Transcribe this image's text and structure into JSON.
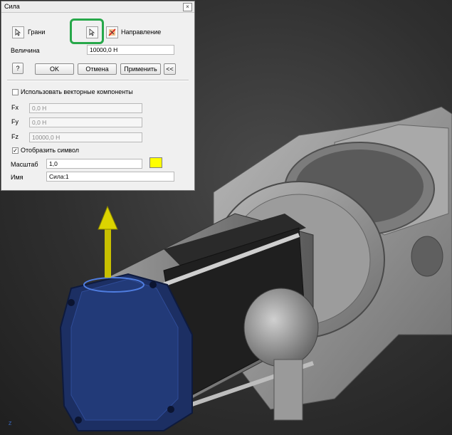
{
  "dialog": {
    "title": "Сила",
    "close_glyph": "×",
    "faces_label": "Грани",
    "direction_label": "Направление",
    "magnitude_label": "Величина",
    "magnitude_value": "10000,0 Н",
    "help_glyph": "?",
    "ok_label": "OK",
    "cancel_label": "Отмена",
    "apply_label": "Применить",
    "more_label": "<<",
    "vector_components_label": "Использовать векторные компоненты",
    "vector_components_checked": false,
    "fx_label": "Fx",
    "fx_value": "0,0 Н",
    "fy_label": "Fy",
    "fy_value": "0,0 Н",
    "fz_label": "Fz",
    "fz_value": "10000,0 Н",
    "show_glyph_label": "Отобразить символ",
    "show_glyph_checked": true,
    "check_mark": "✓",
    "scale_label": "Масштаб",
    "scale_value": "1,0",
    "glyph_color": "#ffff00",
    "name_label": "Имя",
    "name_value": "Сила:1",
    "highlight_color": "#27a84a"
  },
  "viewport": {
    "axis_label": "Z",
    "model_color": "#8c8c8c",
    "selected_face_color": "#1c2f63",
    "force_arrow_color": "#c8c000"
  }
}
